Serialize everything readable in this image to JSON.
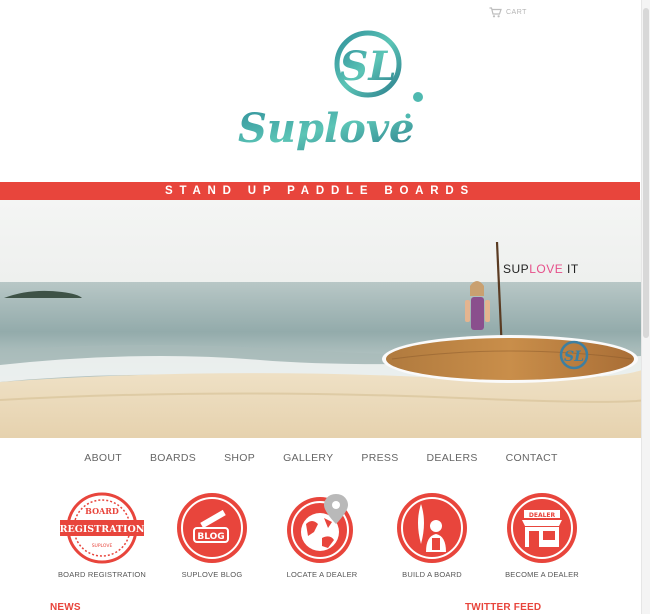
{
  "header": {
    "cart_label": "CART",
    "logo_text": "Suplove",
    "logo_monogram": "SL"
  },
  "banner": {
    "text": "STAND UP PADDLE BOARDS"
  },
  "hero": {
    "tagline_part1": "SUP",
    "tagline_part2": "LOVE",
    "tagline_part3": " IT"
  },
  "nav": {
    "items": [
      "ABOUT",
      "BOARDS",
      "SHOP",
      "GALLERY",
      "PRESS",
      "DEALERS",
      "CONTACT"
    ]
  },
  "features": {
    "items": [
      {
        "label": "BOARD REGISTRATION",
        "badge_top": "BOARD",
        "badge_main": "REGISTRATION",
        "badge_bottom": "SUPLOVE"
      },
      {
        "label": "SUPLOVE BLOG",
        "badge_main": "BLOG"
      },
      {
        "label": "LOCATE A DEALER"
      },
      {
        "label": "BUILD A BOARD"
      },
      {
        "label": "BECOME A DEALER",
        "badge_main": "DEALER"
      }
    ]
  },
  "sections": {
    "news": "NEWS",
    "twitter": "TWITTER FEED"
  },
  "colors": {
    "accent": "#e8453c",
    "pink": "#e6508a",
    "logo_teal": "#3aa6a0"
  }
}
